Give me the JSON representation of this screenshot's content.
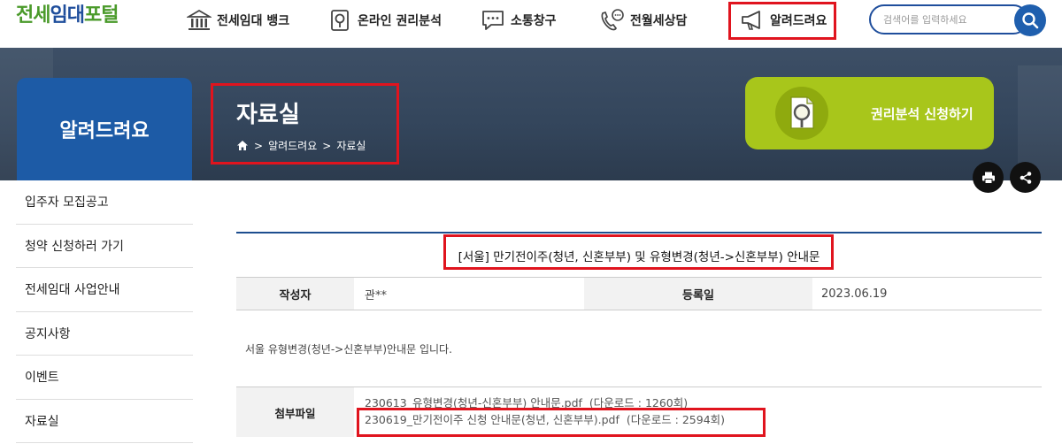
{
  "header": {
    "logo": {
      "part1": "전세",
      "part2": "임대",
      "part3": "포털"
    },
    "nav": [
      {
        "label": "전세임대 뱅크",
        "icon": "bank-icon"
      },
      {
        "label": "온라인 권리분석",
        "icon": "document-search-icon"
      },
      {
        "label": "소통창구",
        "icon": "chat-bubble-icon"
      },
      {
        "label": "전월세상담",
        "icon": "phone-chat-icon"
      },
      {
        "label": "알려드려요",
        "icon": "megaphone-icon"
      }
    ],
    "search_placeholder": "검색어를 입력하세요"
  },
  "banner": {
    "section_title": "알려드려요",
    "page_title": "자료실",
    "breadcrumb": [
      "알려드려요",
      "자료실"
    ],
    "apply_button": "권리분석 신청하기"
  },
  "sidebar": {
    "items": [
      {
        "label": "입주자 모집공고"
      },
      {
        "label": "청약 신청하러 가기"
      },
      {
        "label": "전세임대 사업안내"
      },
      {
        "label": "공지사항"
      },
      {
        "label": "이벤트"
      },
      {
        "label": "자료실"
      }
    ]
  },
  "post": {
    "title": "[서울] 만기전이주(청년, 신혼부부) 및 유형변경(청년->신혼부부) 안내문",
    "author_label": "작성자",
    "author": "관**",
    "date_label": "등록일",
    "date": "2023.06.19",
    "body": "서울 유형변경(청년->신혼부부)안내문 입니다.",
    "attach_label": "첨부파일",
    "files": [
      {
        "name": "230613_유형변경(청년-신혼부부) 안내문.pdf",
        "downloads": "(다운로드 : 1260회)"
      },
      {
        "name": "230619_만기전이주 신청 안내문(청년, 신혼부부).pdf",
        "downloads": "(다운로드 : 2594회)"
      }
    ]
  },
  "colors": {
    "accent_blue": "#1d5ba6",
    "apply_green": "#a8c61b",
    "highlight_red": "#e0141e",
    "banner_bg": "#33455b"
  }
}
